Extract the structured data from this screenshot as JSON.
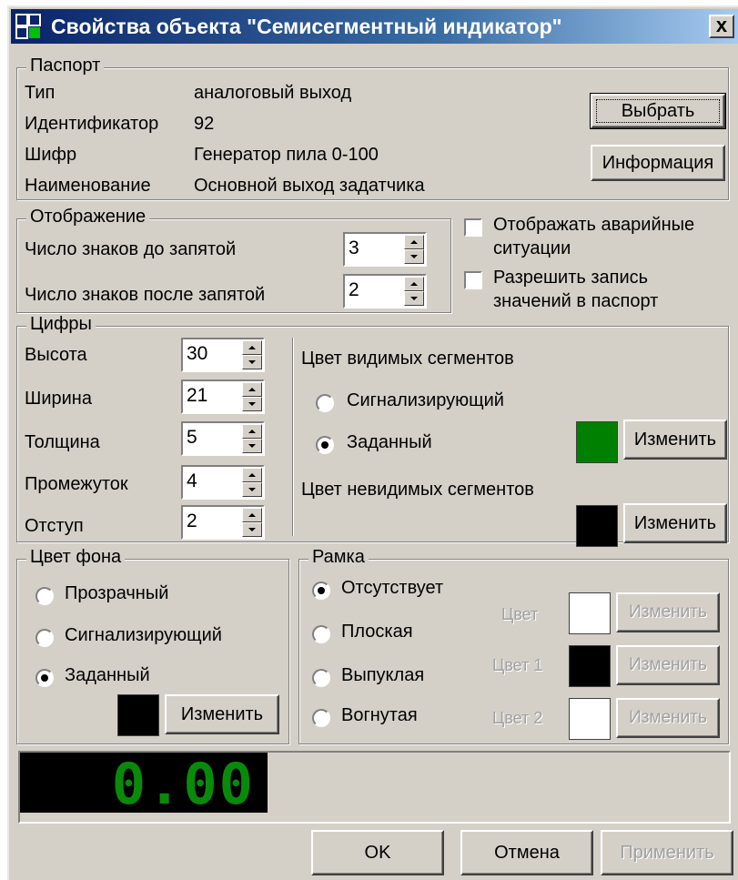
{
  "window": {
    "title": "Свойства объекта \"Семисегментный индикатор\"",
    "close_glyph": "x"
  },
  "passport": {
    "legend": "Паспорт",
    "rows": [
      {
        "label": "Тип",
        "value": "аналоговый выход"
      },
      {
        "label": "Идентификатор",
        "value": "92"
      },
      {
        "label": "Шифр",
        "value": "Генератор пила 0-100"
      },
      {
        "label": "Наименование",
        "value": "Основной выход задатчика"
      }
    ],
    "select_button": "Выбрать",
    "info_button": "Информация"
  },
  "display": {
    "legend": "Отображение",
    "digits_before_label": "Число знаков до запятой",
    "digits_before_value": "3",
    "digits_after_label": "Число знаков после запятой",
    "digits_after_value": "2",
    "show_alarms_label_1": "Отображать аварийные",
    "show_alarms_label_2": "ситуации",
    "show_alarms_checked": false,
    "allow_write_label_1": "Разрешить запись",
    "allow_write_label_2": "значений в паспорт",
    "allow_write_checked": false
  },
  "digits": {
    "legend": "Цифры",
    "params": [
      {
        "label": "Высота",
        "value": "30"
      },
      {
        "label": "Ширина",
        "value": "21"
      },
      {
        "label": "Толщина",
        "value": "5"
      },
      {
        "label": "Промежуток",
        "value": "4"
      },
      {
        "label": "Отступ",
        "value": "2"
      }
    ],
    "visible_title": "Цвет видимых сегментов",
    "opt_signal": "Сигнализирующий",
    "opt_set": "Заданный",
    "visible_selected": "Заданный",
    "visible_color": "#008000",
    "change_label": "Изменить",
    "invisible_title": "Цвет невидимых сегментов",
    "invisible_color": "#000000"
  },
  "background": {
    "legend": "Цвет фона",
    "options": [
      "Прозрачный",
      "Сигнализирующий",
      "Заданный"
    ],
    "selected": "Заданный",
    "color": "#000000",
    "change_label": "Изменить"
  },
  "frame": {
    "legend": "Рамка",
    "options": [
      "Отсутствует",
      "Плоская",
      "Выпуклая",
      "Вогнутая"
    ],
    "selected": "Отсутствует",
    "color_label": "Цвет",
    "color1_label": "Цвет 1",
    "color2_label": "Цвет 2",
    "color": "#ffffff",
    "color1": "#000000",
    "color2": "#ffffff",
    "change_label": "Изменить"
  },
  "preview": {
    "value": "0.00",
    "digit_color": "#0a8a0a",
    "background": "#000000"
  },
  "footer": {
    "ok": "OK",
    "cancel": "Отмена",
    "apply": "Применить"
  }
}
